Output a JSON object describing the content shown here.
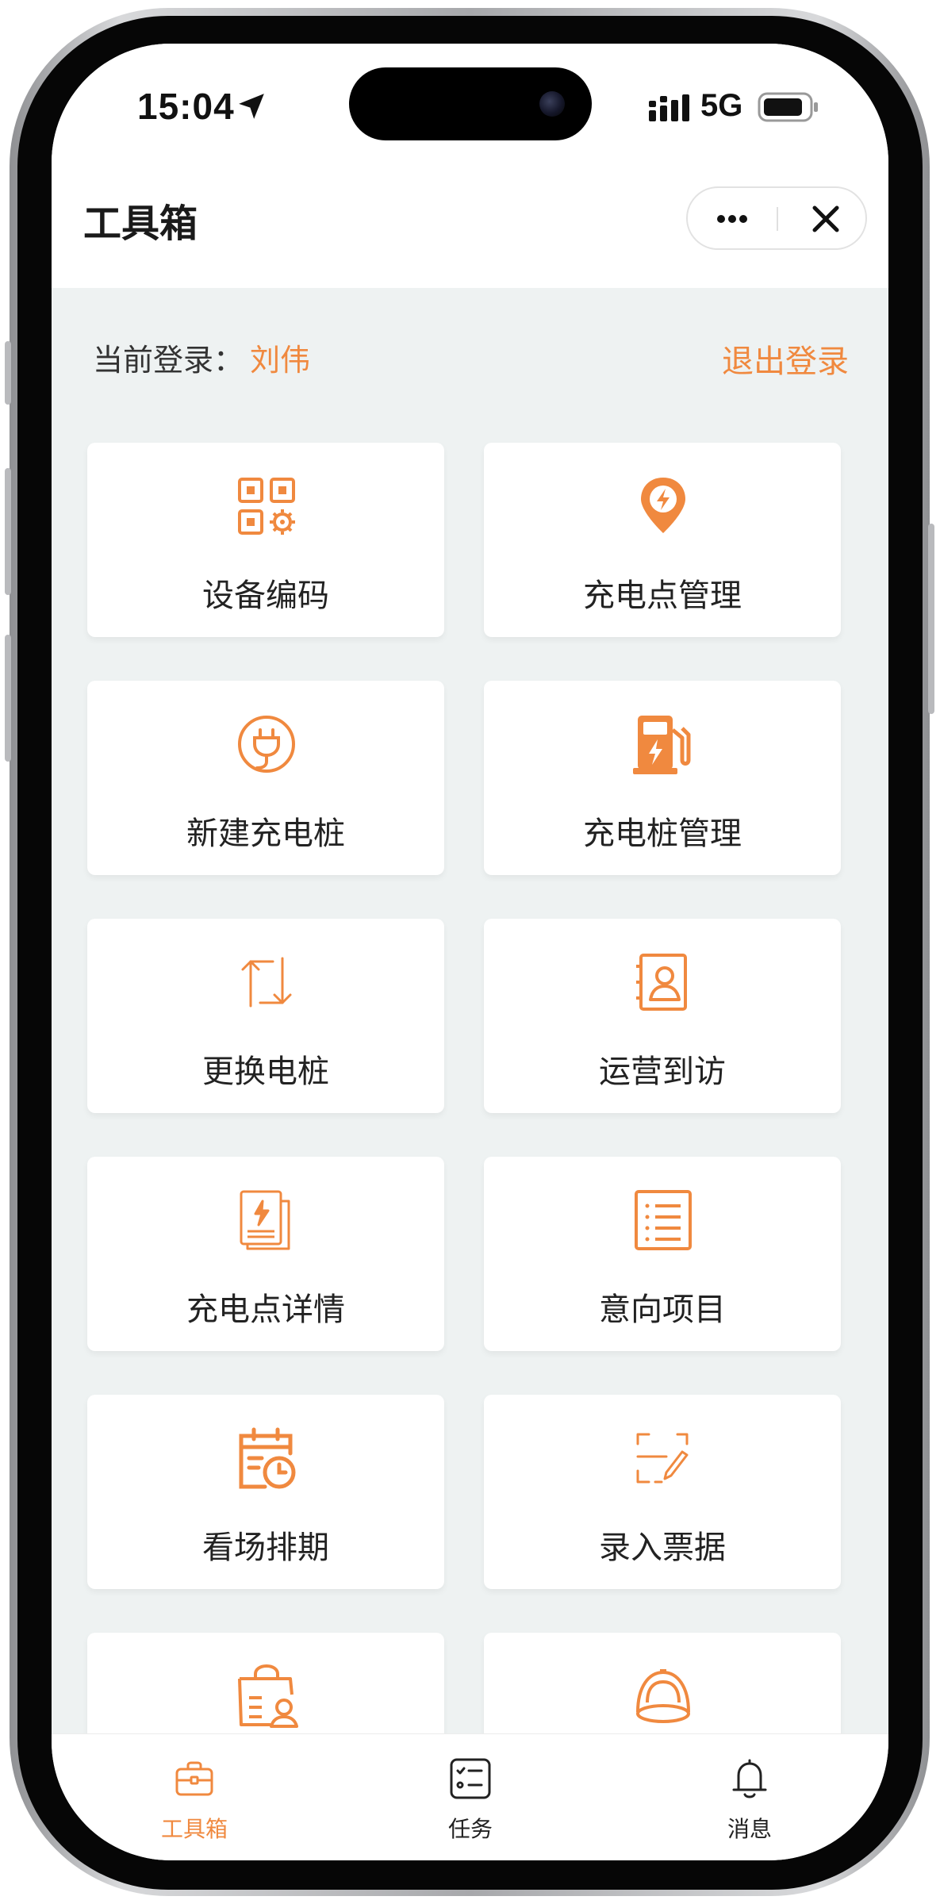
{
  "status_bar": {
    "time": "15:04",
    "network": "5G"
  },
  "header": {
    "title": "工具箱"
  },
  "login": {
    "prefix": "当前登录：",
    "user": "刘伟",
    "logout": "退出登录"
  },
  "tools": [
    {
      "label": "设备编码",
      "icon": "qr-code-gear-icon"
    },
    {
      "label": "充电点管理",
      "icon": "charging-location-pin-icon"
    },
    {
      "label": "新建充电桩",
      "icon": "plug-circle-icon"
    },
    {
      "label": "充电桩管理",
      "icon": "fuel-pump-icon"
    },
    {
      "label": "更换电桩",
      "icon": "swap-arrows-icon"
    },
    {
      "label": "运营到访",
      "icon": "contact-book-icon"
    },
    {
      "label": "充电点详情",
      "icon": "charging-document-icon"
    },
    {
      "label": "意向项目",
      "icon": "list-document-icon"
    },
    {
      "label": "看场排期",
      "icon": "schedule-clock-icon"
    },
    {
      "label": "录入票据",
      "icon": "scan-edit-icon"
    },
    {
      "label": "",
      "icon": "shopping-bag-user-icon"
    },
    {
      "label": "",
      "icon": "helmet-icon"
    }
  ],
  "tabs": [
    {
      "label": "工具箱",
      "icon": "toolbox-icon",
      "active": true
    },
    {
      "label": "任务",
      "icon": "task-list-icon",
      "active": false
    },
    {
      "label": "消息",
      "icon": "bell-icon",
      "active": false
    }
  ],
  "colors": {
    "accent": "#f0893f",
    "background": "#eef2f2",
    "card": "#ffffff"
  }
}
